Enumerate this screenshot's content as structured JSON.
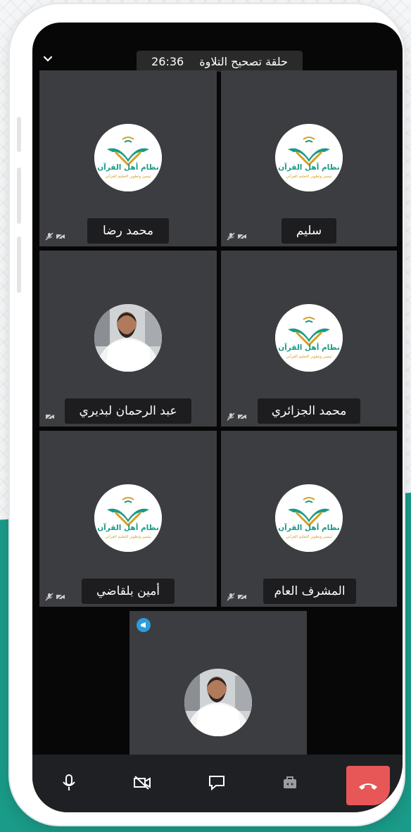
{
  "call": {
    "title": "حلقة تصحيح التلاوة",
    "timer": "26:36"
  },
  "logo": {
    "line1": "نظام أهل القرآن",
    "line2": "تيسير وتطوير التعليم القرآني"
  },
  "participants": [
    {
      "name": "سليم",
      "image": "logo"
    },
    {
      "name": "محمد رضا",
      "image": "logo"
    },
    {
      "name": "محمد الجزائري",
      "image": "logo"
    },
    {
      "name": "عبد الرحمان لبديري",
      "image": "photo"
    },
    {
      "name": "المشرف العام",
      "image": "logo"
    },
    {
      "name": "أمين بلقاضي",
      "image": "logo"
    }
  ],
  "icons": {
    "collapse": "chevron-down-icon",
    "muted_mic": "mic-off-icon",
    "camera_off": "video-off-icon",
    "speaker_badge": "megaphone-icon",
    "toolbar": [
      "microphone-icon",
      "video-off-icon",
      "chat-icon",
      "toolbox-icon",
      "end-call-icon"
    ]
  },
  "colors": {
    "tile": "#3c3d40",
    "end_call": "#e85757",
    "speaker_badge": "#2d9cdb",
    "brand_teal": "#1a9a88",
    "brand_gold": "#d4a020"
  }
}
